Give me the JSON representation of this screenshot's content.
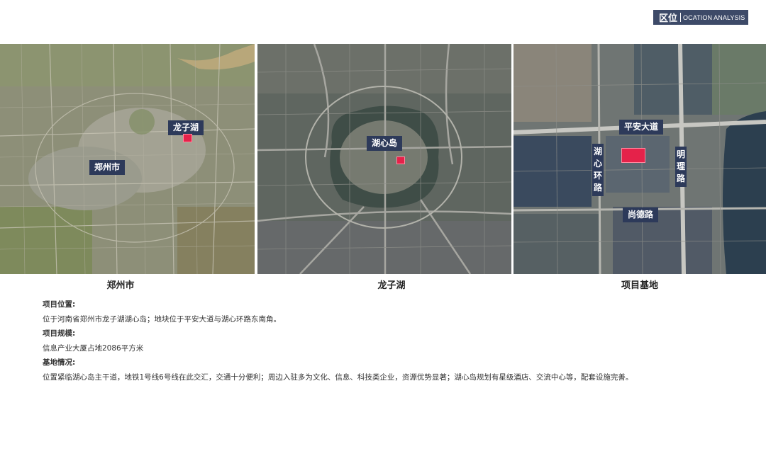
{
  "header": {
    "title_zh": "区位",
    "title_en": "OCATION ANALYSIS"
  },
  "maps": [
    {
      "label": "郑州市",
      "marker_label": "龙子湖",
      "caption": "郑州市"
    },
    {
      "label": "湖心岛",
      "caption": "龙子湖"
    },
    {
      "road_h1": "平安大道",
      "road_v1": "湖心环路",
      "road_v2": "明理路",
      "road_h2": "尚德路",
      "caption": "项目基地"
    }
  ],
  "info": {
    "location_head": "项目位置:",
    "location_text": "位于河南省郑州市龙子湖湖心岛；地块位于平安大道与湖心环路东南角。",
    "scale_head": "项目规模:",
    "scale_text": "信息产业大厦占地2086平方米",
    "site_head": "基地情况:",
    "site_text": "位置紧临湖心岛主干道，地铁1号线6号线在此交汇，交通十分便利；周边入驻多为文化、信息、科技类企业，资源优势显著；湖心岛规划有星级酒店、交流中心等，配套设施完善。"
  },
  "colors": {
    "badge": "#3d4a68",
    "label": "#2d3a5a",
    "marker": "#e5224a"
  }
}
